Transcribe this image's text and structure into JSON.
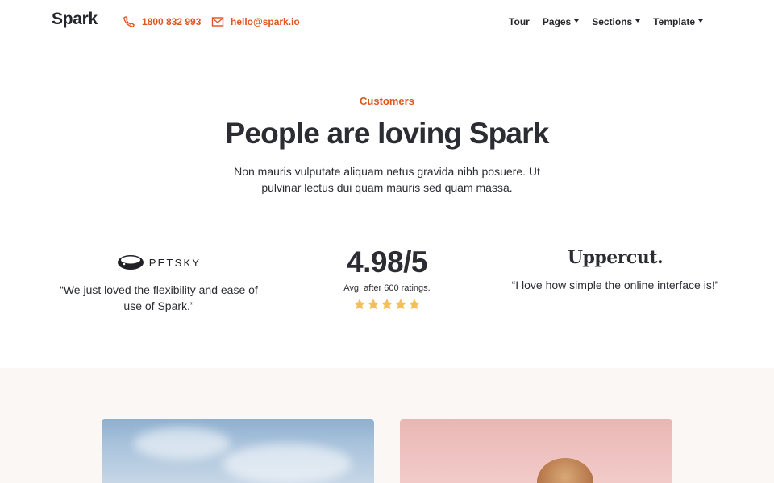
{
  "nav": {
    "brand": "Spark",
    "phone": "1800 832 993",
    "email": "hello@spark.io",
    "menu": [
      {
        "label": "Tour",
        "has_dropdown": false
      },
      {
        "label": "Pages",
        "has_dropdown": true
      },
      {
        "label": "Sections",
        "has_dropdown": true
      },
      {
        "label": "Template",
        "has_dropdown": true
      }
    ]
  },
  "hero": {
    "eyebrow": "Customers",
    "headline": "People are loving Spark",
    "lead": "Non mauris vulputate aliquam netus gravida nibh posuere. Ut pulvinar lectus dui quam mauris sed quam massa."
  },
  "testimonials": {
    "left": {
      "logo_text": "PETSKY",
      "quote": "“We just loved the flexibility and ease of use of Spark.”"
    },
    "center": {
      "rating": "4.98/5",
      "subtitle": "Avg. after 600 ratings.",
      "stars": 5
    },
    "right": {
      "logo_text": "Uppercut.",
      "quote": "“I love how simple the online interface is!”"
    }
  },
  "colors": {
    "accent": "#e2541f",
    "text": "#2b2d33",
    "star": "#f4bf5b",
    "section_bg": "#faf7f4"
  },
  "icons": {
    "phone": "phone-icon",
    "mail": "mail-icon",
    "star": "star-icon"
  }
}
